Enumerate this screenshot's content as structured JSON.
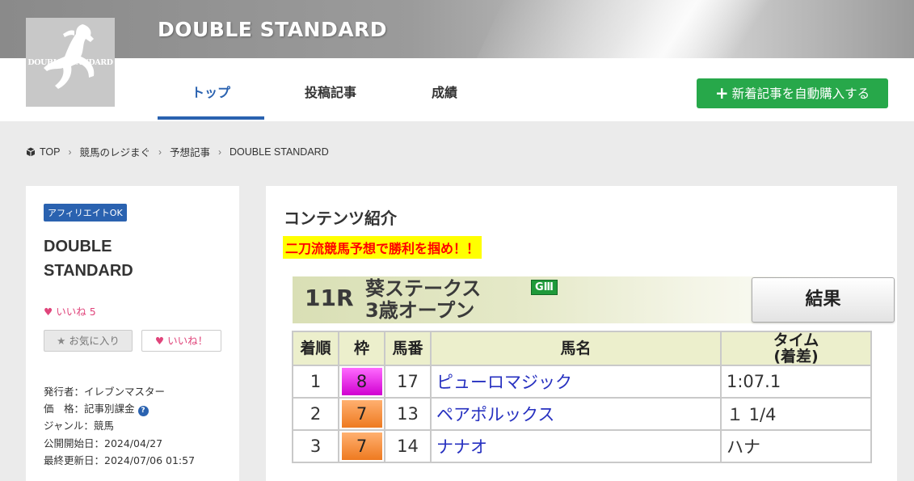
{
  "header": {
    "site_title": "DOUBLE STANDARD",
    "logo_text": "DOUBLE STANDARD",
    "nav_tabs": [
      {
        "label": "トップ",
        "active": true
      },
      {
        "label": "投稿記事",
        "active": false
      },
      {
        "label": "成績",
        "active": false
      }
    ],
    "buy_button_label": "新着記事を自動購入する",
    "accent_color": "#2a62b0",
    "buy_button_color": "#27a84a"
  },
  "breadcrumb": {
    "items": [
      "TOP",
      "競馬のレジまぐ",
      "予想記事",
      "DOUBLE STANDARD"
    ]
  },
  "sidebar": {
    "badge": "アフィリエイトOK",
    "title_line1": "DOUBLE",
    "title_line2": "STANDARD",
    "like_count_label": "いいね",
    "like_count": "5",
    "favorite_button": "お気に入り",
    "like_button": "いいね！",
    "meta": {
      "publisher": "発行者：イレブンマスター",
      "price": "価　格：記事別課金",
      "genre": "ジャンル：競馬",
      "start_date": "公開開始日：2024/04/27",
      "updated": "最終更新日：2024/07/06 01:57"
    }
  },
  "main": {
    "heading": "コンテンツ紹介",
    "highlight": "二刀流競馬予想で勝利を掴め！！",
    "race": {
      "number": "11R",
      "name_line1": "葵ステークス",
      "name_line2": "3歳オープン",
      "grade": "GⅢ",
      "result_button": "結果"
    },
    "table": {
      "headers": [
        "着順",
        "枠",
        "馬番",
        "馬名",
        "タイム",
        "(着差)"
      ],
      "rows": [
        {
          "rank": "1",
          "waku": "8",
          "num": "17",
          "name": "ピューロマジック",
          "time": "1:07.1",
          "waku_color": "pink"
        },
        {
          "rank": "2",
          "waku": "7",
          "num": "13",
          "name": "ペアポルックス",
          "time": "１ 1/4",
          "waku_color": "orange"
        },
        {
          "rank": "3",
          "waku": "7",
          "num": "14",
          "name": "ナナオ",
          "time": "ハナ",
          "waku_color": "orange"
        }
      ]
    }
  }
}
